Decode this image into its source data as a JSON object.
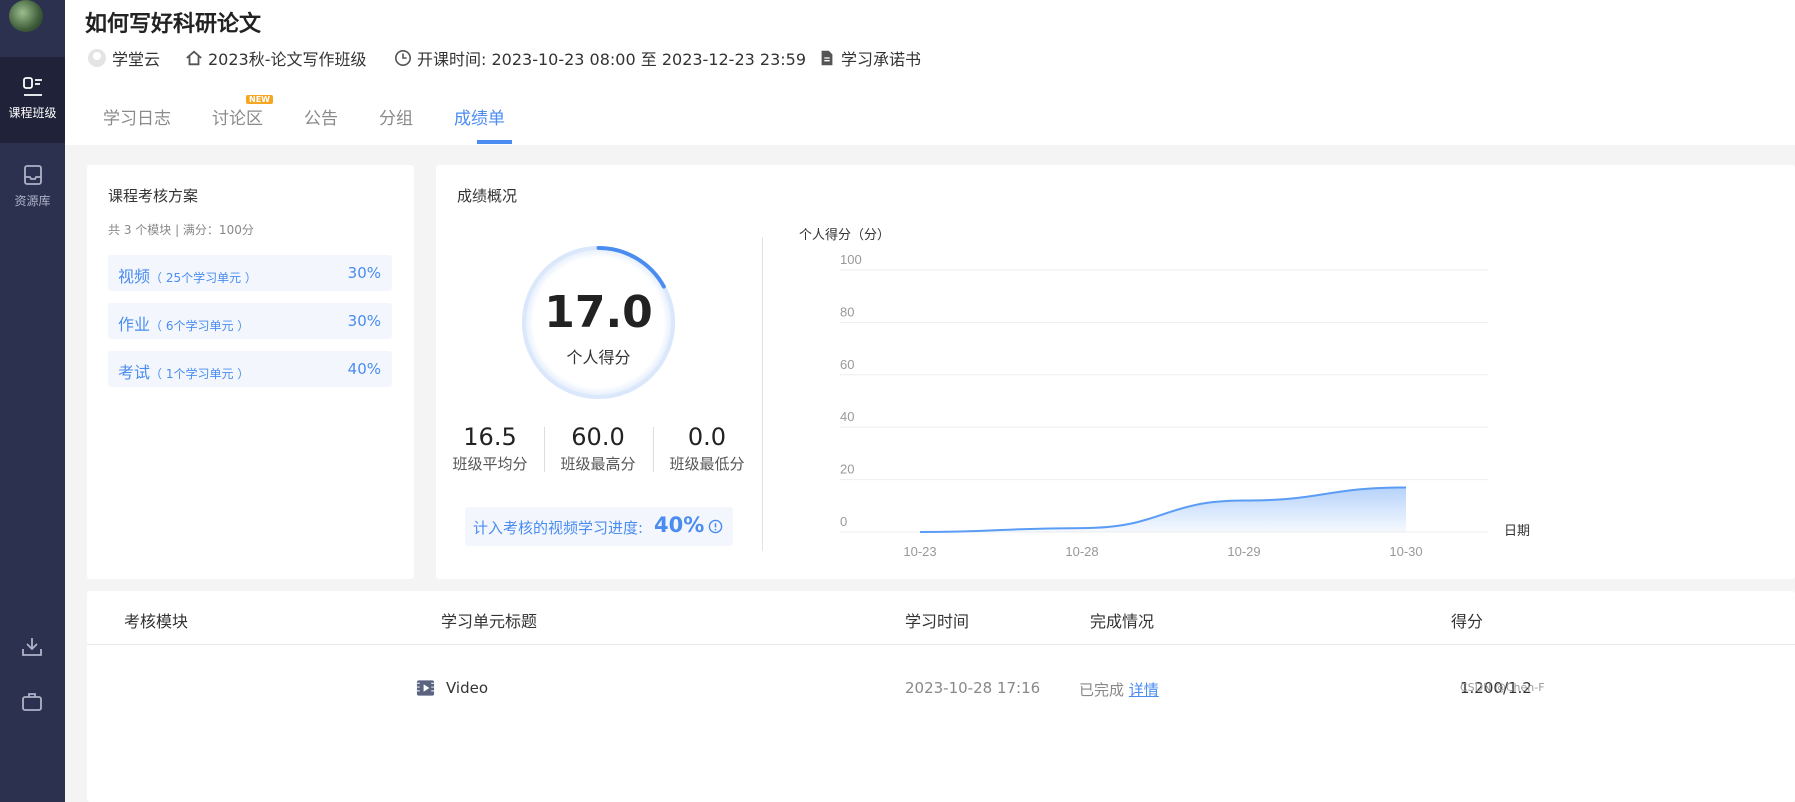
{
  "sidebar": {
    "items": [
      {
        "label": "课程班级",
        "icon": "class-icon",
        "active": true
      },
      {
        "label": "资源库",
        "icon": "library-icon",
        "active": false
      }
    ],
    "bottom_icons": [
      "download-icon",
      "briefcase-icon"
    ]
  },
  "header": {
    "title": "如何写好科研论文",
    "meta": {
      "platform": "学堂云",
      "class_name": "2023秋-论文写作班级",
      "schedule_label": "开课时间: 2023-10-23 08:00 至 2023-12-23 23:59",
      "pledge": "学习承诺书"
    },
    "tabs": [
      {
        "label": "学习日志",
        "active": false
      },
      {
        "label": "讨论区",
        "active": false,
        "badge": "NEW"
      },
      {
        "label": "公告",
        "active": false
      },
      {
        "label": "分组",
        "active": false
      },
      {
        "label": "成绩单",
        "active": true
      }
    ]
  },
  "assessment": {
    "title": "课程考核方案",
    "subtitle": "共 3 个模块 | 满分：100分",
    "modules": [
      {
        "name": "视频",
        "units": "（ 25个学习单元 ）",
        "weight": "30%"
      },
      {
        "name": "作业",
        "units": "（ 6个学习单元 ）",
        "weight": "30%"
      },
      {
        "name": "考试",
        "units": "（ 1个学习单元 ）",
        "weight": "40%"
      }
    ]
  },
  "overview": {
    "title": "成绩概况",
    "score": "17.0",
    "score_label": "个人得分",
    "score_fraction": 0.17,
    "stats": [
      {
        "value": "16.5",
        "label": "班级平均分"
      },
      {
        "value": "60.0",
        "label": "班级最高分"
      },
      {
        "value": "0.0",
        "label": "班级最低分"
      }
    ],
    "progress_label": "计入考核的视频学习进度:",
    "progress_value": "40%"
  },
  "chart_data": {
    "type": "area",
    "ylabel": "个人得分（分）",
    "xlabel": "日期",
    "ylim": [
      0,
      100
    ],
    "yticks": [
      0,
      20,
      40,
      60,
      80,
      100
    ],
    "categories": [
      "10-23",
      "10-28",
      "10-29",
      "10-30"
    ],
    "values": [
      0,
      1.5,
      12,
      17
    ],
    "grid": true,
    "color": "#5b9cf5"
  },
  "table": {
    "headers": [
      "考核模块",
      "学习单元标题",
      "学习时间",
      "完成情况",
      "得分"
    ],
    "rows": [
      {
        "module": "",
        "title": "Video",
        "time": "2023-10-28 17:16",
        "status": "已完成",
        "detail": "详情",
        "score": "1.200/1.2"
      }
    ]
  },
  "watermark": "CSDN @Chen-F",
  "colors": {
    "accent": "#4a8cf0",
    "sidebar": "#2c3150",
    "sidebar_active": "#1f2238",
    "badge": "#f5a623"
  }
}
